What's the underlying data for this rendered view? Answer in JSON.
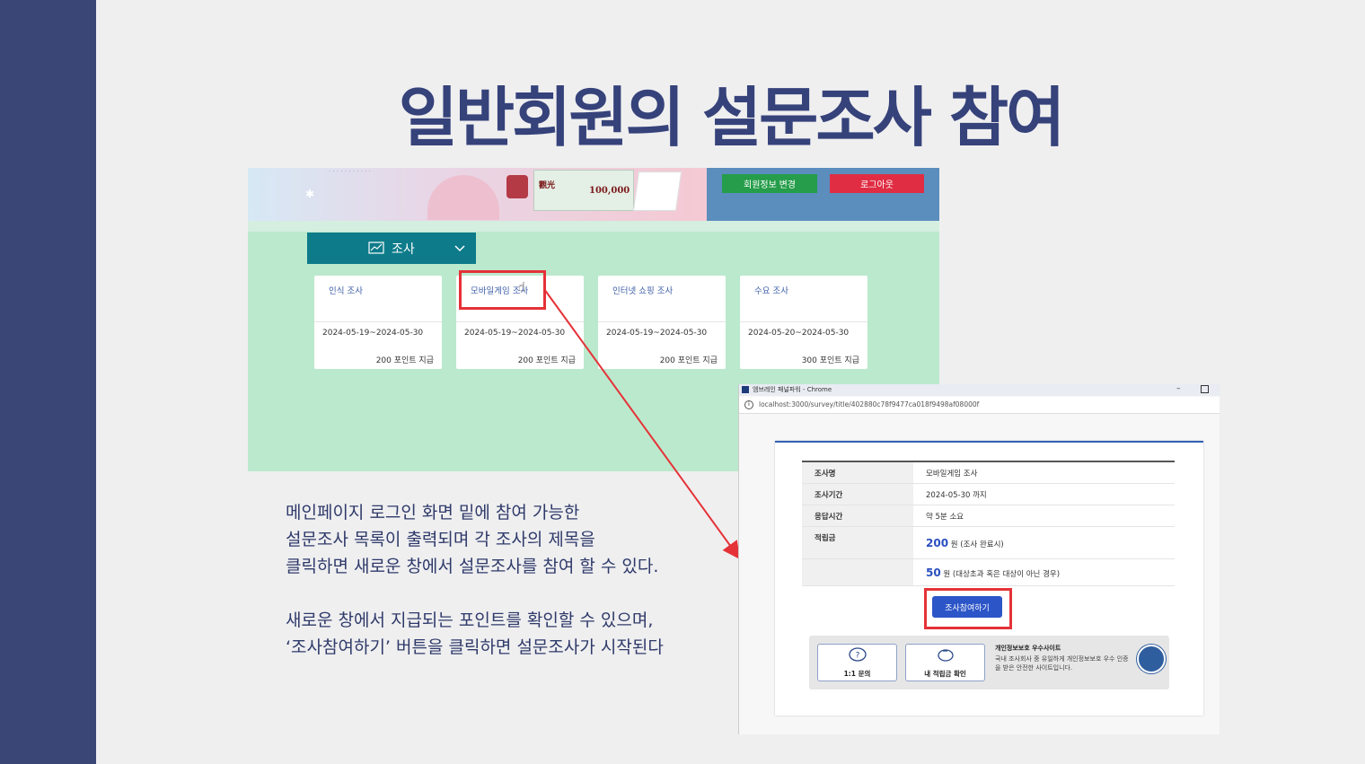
{
  "slide": {
    "title": "일반회원의 설문조사 참여",
    "description_1": [
      "메인페이지 로그인 화면 밑에 참여 가능한",
      "설문조사 목록이 출력되며 각 조사의 제목을",
      "클릭하면 새로운 창에서 설문조사를 참여 할 수 있다."
    ],
    "description_2": [
      "새로운 창에서 지급되는 포인트를 확인할 수 있으며,",
      "‘조사참여하기’ 버튼을 클릭하면 설문조사가 시작된다"
    ]
  },
  "main_screen": {
    "header": {
      "profile_button": "회원정보 변경",
      "logout_button": "로그아웃",
      "banner_ticket": "100,000",
      "banner_ticket_kanji": "觀光"
    },
    "survey_menu": {
      "label": "조사",
      "icon": "chart-icon",
      "chevron": "chevron-down-icon"
    },
    "cards": [
      {
        "title": "인식 조사",
        "period": "2024-05-19~2024-05-30",
        "points": "200 포인트 지급"
      },
      {
        "title": "모바일게임 조사",
        "period": "2024-05-19~2024-05-30",
        "points": "200 포인트 지급"
      },
      {
        "title": "인터넷 쇼핑 조사",
        "period": "2024-05-19~2024-05-30",
        "points": "200 포인트 지급"
      },
      {
        "title": "수요 조사",
        "period": "2024-05-20~2024-05-30",
        "points": "300 포인트 지급"
      }
    ]
  },
  "popup": {
    "window_title": "엠브레인 패널파워 - Chrome",
    "url": "localhost:3000/survey/title/402880c78f9477ca018f9498af08000f",
    "table": {
      "row1_label": "조사명",
      "row1_value": "모바일게임 조사",
      "row2_label": "조사기간",
      "row2_value": "2024-05-30 까지",
      "row3_label": "응답시간",
      "row3_value": "약 5분 소요",
      "row4_label": "적립금",
      "reward1_amount": "200",
      "reward1_text": "원 (조사 완료시)",
      "reward2_amount": "50",
      "reward2_text": "원 (대상초과 혹은 대상이 아닌 경우)"
    },
    "join_button": "조사참여하기",
    "footer": {
      "inquiry_button": "1:1 문의",
      "points_button": "내 적립금 확인",
      "privacy_title": "개인정보보호 우수사이트",
      "privacy_text": "국내 조사회사 중 유일하게 개인정보보호 우수 인증을 받은 안전한 사이트입니다."
    }
  },
  "colors": {
    "sidebar": "#3a4676",
    "title": "#36427a",
    "highlight": "#e53238",
    "join_button": "#2c55c8"
  }
}
